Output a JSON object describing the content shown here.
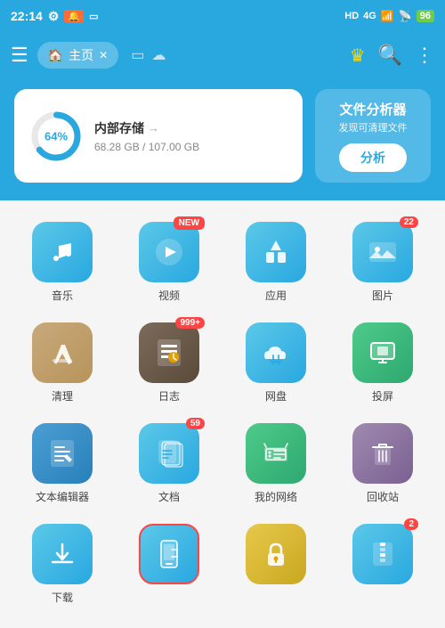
{
  "statusBar": {
    "time": "22:14",
    "battery": "96"
  },
  "topNav": {
    "menuLabel": "☰",
    "tabHome": "主页",
    "moreIcons": [
      "▭",
      "☁"
    ]
  },
  "storageCard": {
    "title": "内部存储",
    "arrow": "→",
    "used": "68.28 GB",
    "total": "107.00 GB",
    "percent": "64%",
    "percentNum": 64
  },
  "fileAnalyzer": {
    "title": "文件分析器",
    "subtitle": "发现可清理文件",
    "button": "分析"
  },
  "gridItems": [
    {
      "id": "music",
      "label": "音乐",
      "icon": "music",
      "badge": null,
      "badgeNew": false
    },
    {
      "id": "video",
      "label": "视频",
      "icon": "video",
      "badge": null,
      "badgeNew": true
    },
    {
      "id": "app",
      "label": "应用",
      "icon": "app",
      "badge": null,
      "badgeNew": false
    },
    {
      "id": "photo",
      "label": "图片",
      "icon": "photo",
      "badge": "22",
      "badgeNew": false
    },
    {
      "id": "clean",
      "label": "清理",
      "icon": "clean",
      "badge": null,
      "badgeNew": false
    },
    {
      "id": "log",
      "label": "日志",
      "icon": "log",
      "badge": "999+",
      "badgeNew": false
    },
    {
      "id": "cloud",
      "label": "网盘",
      "icon": "cloud",
      "badge": null,
      "badgeNew": false
    },
    {
      "id": "cast",
      "label": "投屏",
      "icon": "cast",
      "badge": null,
      "badgeNew": false
    },
    {
      "id": "text",
      "label": "文本编辑器",
      "icon": "text",
      "badge": null,
      "badgeNew": false
    },
    {
      "id": "doc",
      "label": "文档",
      "icon": "doc",
      "badge": "59",
      "badgeNew": false
    },
    {
      "id": "network",
      "label": "我的网络",
      "icon": "network",
      "badge": null,
      "badgeNew": false
    },
    {
      "id": "trash",
      "label": "回收站",
      "icon": "trash",
      "badge": null,
      "badgeNew": false
    },
    {
      "id": "download",
      "label": "下载",
      "icon": "download",
      "badge": null,
      "badgeNew": false
    },
    {
      "id": "phone",
      "label": "",
      "icon": "phone",
      "badge": null,
      "badgeNew": false
    },
    {
      "id": "lock",
      "label": "",
      "icon": "lock",
      "badge": null,
      "badgeNew": false
    },
    {
      "id": "zip",
      "label": "",
      "icon": "zip",
      "badge": "2",
      "badgeNew": false
    }
  ]
}
